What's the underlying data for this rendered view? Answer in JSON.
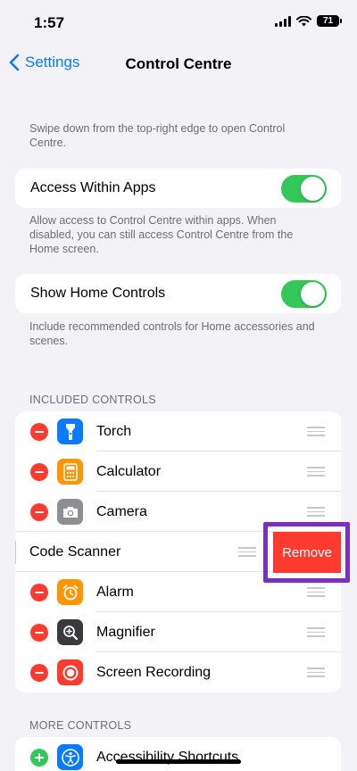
{
  "status": {
    "time": "1:57",
    "battery": "71"
  },
  "nav": {
    "back_label": "Settings",
    "title": "Control Centre"
  },
  "intro_text": "Swipe down from the top-right edge to open Control Centre.",
  "access_within_apps": {
    "label": "Access Within Apps",
    "enabled": true,
    "footnote": "Allow access to Control Centre within apps. When disabled, you can still access Control Centre from the Home screen."
  },
  "show_home_controls": {
    "label": "Show Home Controls",
    "enabled": true,
    "footnote": "Include recommended controls for Home accessories and scenes."
  },
  "included": {
    "header": "INCLUDED CONTROLS",
    "items": [
      {
        "label": "Torch",
        "icon": "torch-icon",
        "color": "#0a7aff"
      },
      {
        "label": "Calculator",
        "icon": "calculator-icon",
        "color": "#ff9500"
      },
      {
        "label": "Camera",
        "icon": "camera-icon",
        "color": "#8e8e93"
      },
      {
        "label": "Code Scanner",
        "icon": "qr-code-icon",
        "color": "#8e8e93",
        "swiped": true
      },
      {
        "label": "Alarm",
        "icon": "alarm-icon",
        "color": "#ff9500"
      },
      {
        "label": "Magnifier",
        "icon": "magnifier-icon",
        "color": "#3a3a3c"
      },
      {
        "label": "Screen Recording",
        "icon": "screen-recording-icon",
        "color": "#ff3b30"
      }
    ],
    "remove_label": "Remove"
  },
  "more": {
    "header": "MORE CONTROLS",
    "items": [
      {
        "label": "Accessibility Shortcuts",
        "icon": "accessibility-icon",
        "color": "#0a7aff"
      }
    ]
  }
}
